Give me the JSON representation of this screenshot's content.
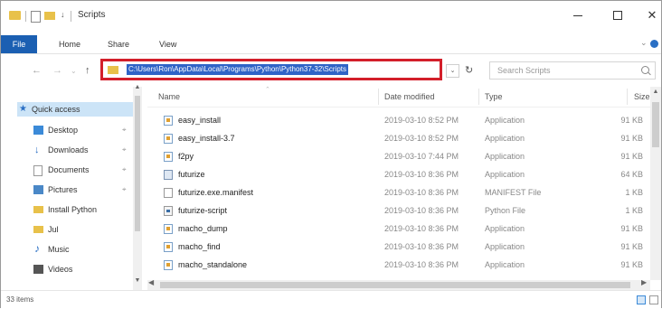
{
  "window": {
    "title": "Scripts",
    "quick_access_caret": "↓"
  },
  "ribbon": {
    "tabs": [
      "File",
      "Home",
      "Share",
      "View"
    ]
  },
  "address": {
    "path": "C:\\Users\\Ron\\AppData\\Local\\Programs\\Python\\Python37-32\\Scripts",
    "highlight_color": "#d31f2a"
  },
  "search": {
    "placeholder": "Search Scripts"
  },
  "nav_pane": {
    "quick_access": "Quick access",
    "items": [
      {
        "label": "Desktop",
        "pinned": true
      },
      {
        "label": "Downloads",
        "pinned": true
      },
      {
        "label": "Documents",
        "pinned": true
      },
      {
        "label": "Pictures",
        "pinned": true
      },
      {
        "label": "Install Python",
        "pinned": false
      },
      {
        "label": "Jul",
        "pinned": false
      },
      {
        "label": "Music",
        "pinned": false
      },
      {
        "label": "Videos",
        "pinned": false
      }
    ]
  },
  "columns": {
    "name": "Name",
    "date": "Date modified",
    "type": "Type",
    "size": "Size"
  },
  "files": [
    {
      "name": "easy_install",
      "date": "2019-03-10 8:52 PM",
      "type": "Application",
      "size": "91 KB",
      "icon": "application-icon"
    },
    {
      "name": "easy_install-3.7",
      "date": "2019-03-10 8:52 PM",
      "type": "Application",
      "size": "91 KB",
      "icon": "application-icon"
    },
    {
      "name": "f2py",
      "date": "2019-03-10 7:44 PM",
      "type": "Application",
      "size": "91 KB",
      "icon": "application-icon"
    },
    {
      "name": "futurize",
      "date": "2019-03-10 8:36 PM",
      "type": "Application",
      "size": "64 KB",
      "icon": "exe-icon"
    },
    {
      "name": "futurize.exe.manifest",
      "date": "2019-03-10 8:36 PM",
      "type": "MANIFEST File",
      "size": "1 KB",
      "icon": "manifest-file-icon"
    },
    {
      "name": "futurize-script",
      "date": "2019-03-10 8:36 PM",
      "type": "Python File",
      "size": "1 KB",
      "icon": "python-file-icon"
    },
    {
      "name": "macho_dump",
      "date": "2019-03-10 8:36 PM",
      "type": "Application",
      "size": "91 KB",
      "icon": "application-icon"
    },
    {
      "name": "macho_find",
      "date": "2019-03-10 8:36 PM",
      "type": "Application",
      "size": "91 KB",
      "icon": "application-icon"
    },
    {
      "name": "macho_standalone",
      "date": "2019-03-10 8:36 PM",
      "type": "Application",
      "size": "91 KB",
      "icon": "application-icon"
    }
  ],
  "status": {
    "item_count": "33 items"
  }
}
